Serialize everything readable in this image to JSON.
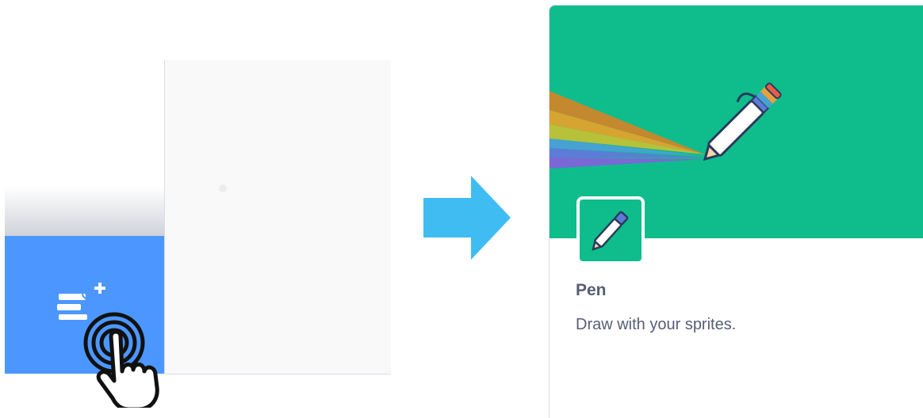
{
  "extension_card": {
    "title": "Pen",
    "description": "Draw with your sprites."
  },
  "icons": {
    "extension_button": "add-extension-icon",
    "cursor": "tap-hand-cursor-icon",
    "arrow": "right-arrow-icon",
    "banner": "rainbow-pen-illustration",
    "tile": "pen-icon"
  },
  "colors": {
    "extension_button": "#4c97ff",
    "card_banner": "#0fbd8c",
    "arrow": "#3fbdf2",
    "text": "#575e75"
  }
}
